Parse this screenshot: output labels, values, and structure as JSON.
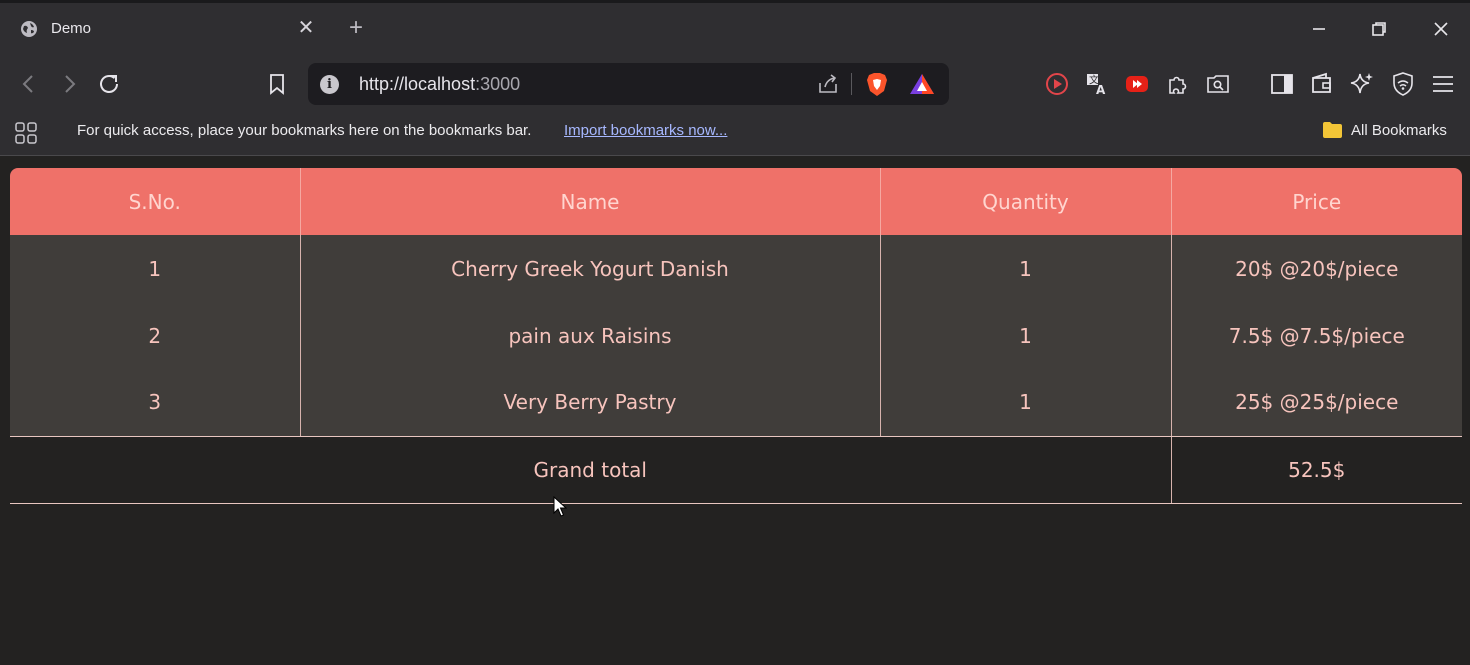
{
  "browser": {
    "tab": {
      "title": "Demo",
      "close_symbol": "✕",
      "favicon": "globe-icon"
    },
    "new_tab_symbol": "+",
    "address": {
      "protocol_host": "http://localhost",
      "port": ":3000"
    },
    "bookmarks_bar": {
      "message": "For quick access, place your bookmarks here on the bookmarks bar.",
      "import_link": "Import bookmarks now...",
      "all_bookmarks": "All Bookmarks"
    },
    "colors": {
      "brave_orange": "#fb542b",
      "accent_link": "#a7b8ff"
    }
  },
  "table": {
    "headers": [
      "S.No.",
      "Name",
      "Quantity",
      "Price"
    ],
    "rows": [
      {
        "sno": "1",
        "name": "Cherry Greek Yogurt Danish",
        "quantity": "1",
        "price": "20$ @20$/piece"
      },
      {
        "sno": "2",
        "name": "pain aux Raisins",
        "quantity": "1",
        "price": "7.5$ @7.5$/piece"
      },
      {
        "sno": "3",
        "name": "Very Berry Pastry",
        "quantity": "1",
        "price": "25$ @25$/piece"
      }
    ],
    "footer": {
      "label": "Grand total",
      "value": "52.5$"
    },
    "colors": {
      "header_bg": "#ef7169",
      "body_bg": "#403d3a",
      "text": "#f7c4bd"
    }
  }
}
